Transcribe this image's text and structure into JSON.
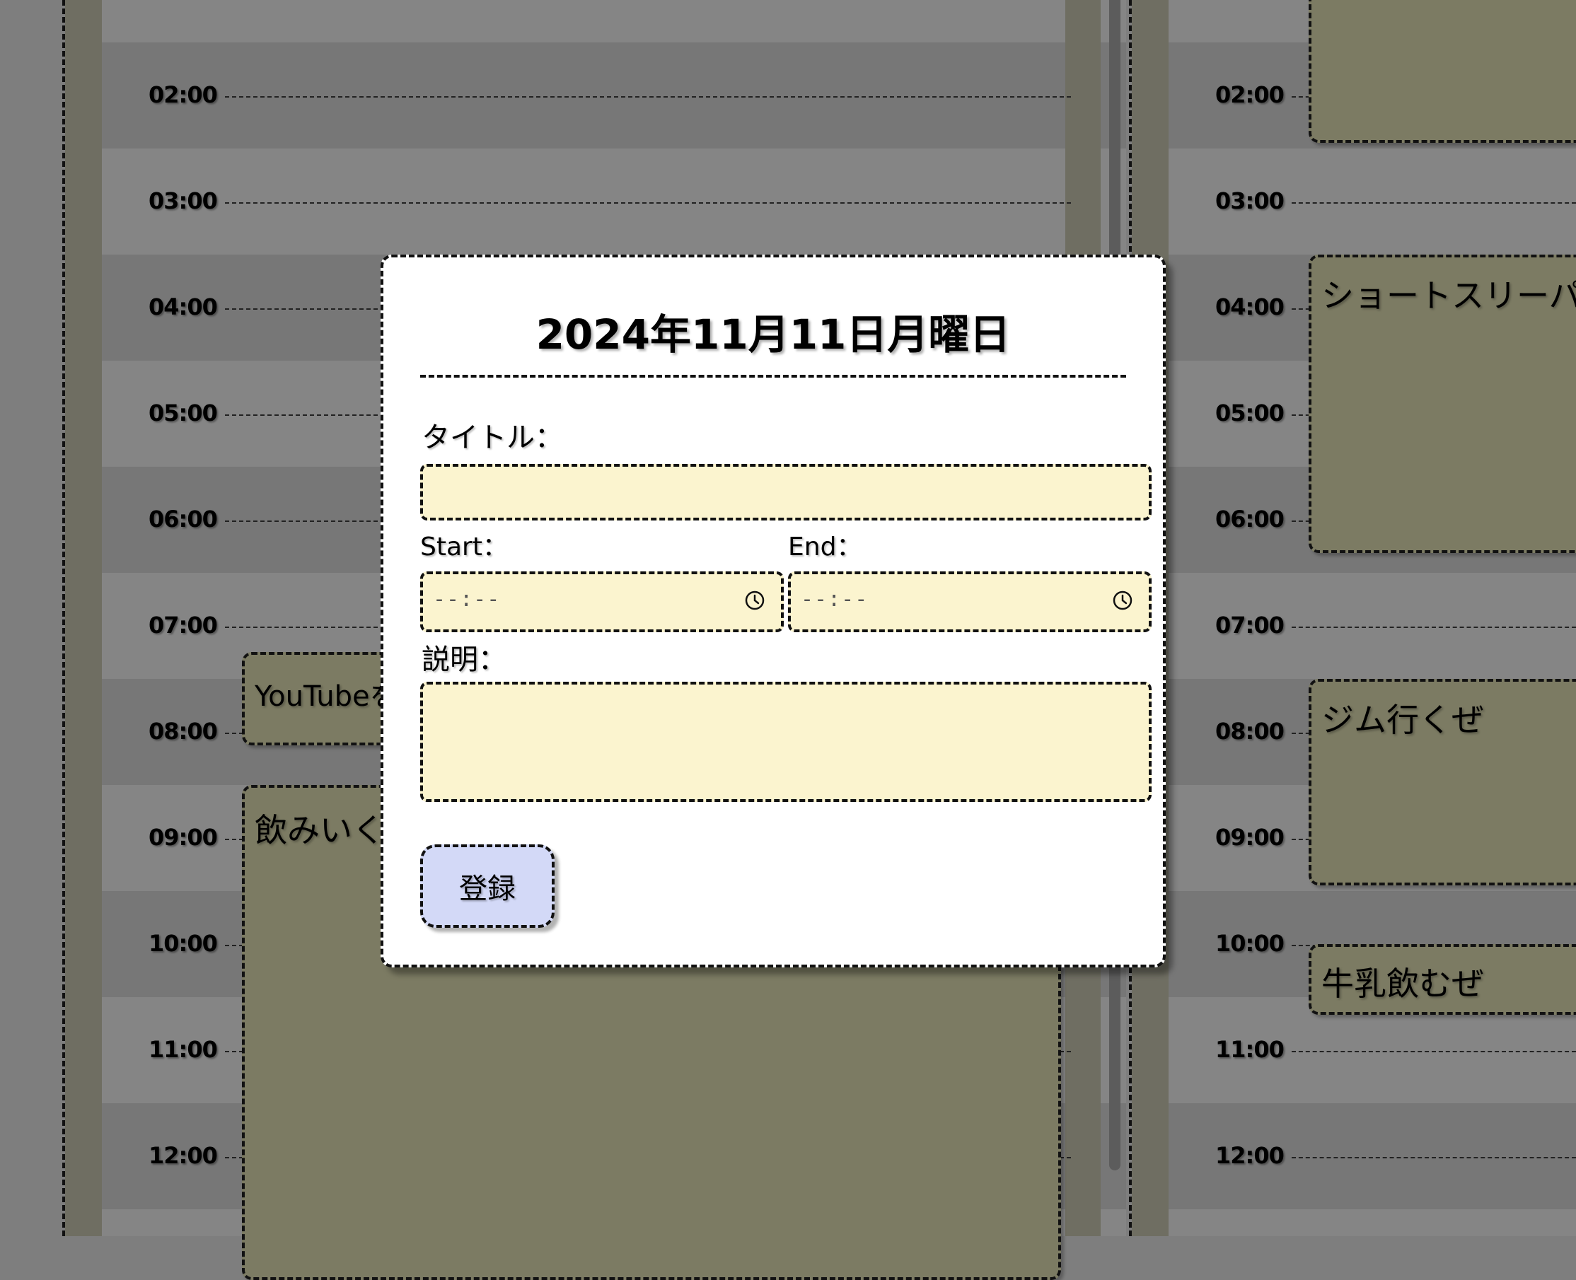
{
  "left_day": {
    "times": [
      "02:00",
      "03:00",
      "04:00",
      "05:00",
      "06:00",
      "07:00",
      "08:00",
      "09:00",
      "10:00",
      "11:00",
      "12:00"
    ],
    "events": [
      {
        "title": "YouTubeを"
      },
      {
        "title": "飲みいく"
      }
    ]
  },
  "right_day": {
    "times": [
      "02:00",
      "03:00",
      "04:00",
      "05:00",
      "06:00",
      "07:00",
      "08:00",
      "09:00",
      "10:00",
      "11:00",
      "12:00"
    ],
    "events": [
      {
        "title": ""
      },
      {
        "title": "ショートスリーパ"
      },
      {
        "title": "ジム行くぜ"
      },
      {
        "title": "牛乳飲むぜ"
      }
    ]
  },
  "modal": {
    "title": "2024年11月11日月曜日",
    "title_label": "タイトル：",
    "title_value": "",
    "start_label": "Start：",
    "end_label": "End：",
    "start_placeholder": "--:--",
    "end_placeholder": "--:--",
    "description_label": "説明：",
    "description_value": "",
    "submit_label": "登録"
  },
  "colors": {
    "overlay": "#7e7e7e",
    "event_fill": "#7c7b63",
    "field_fill": "#fbf4cf",
    "button_fill": "#d3d9f7"
  }
}
